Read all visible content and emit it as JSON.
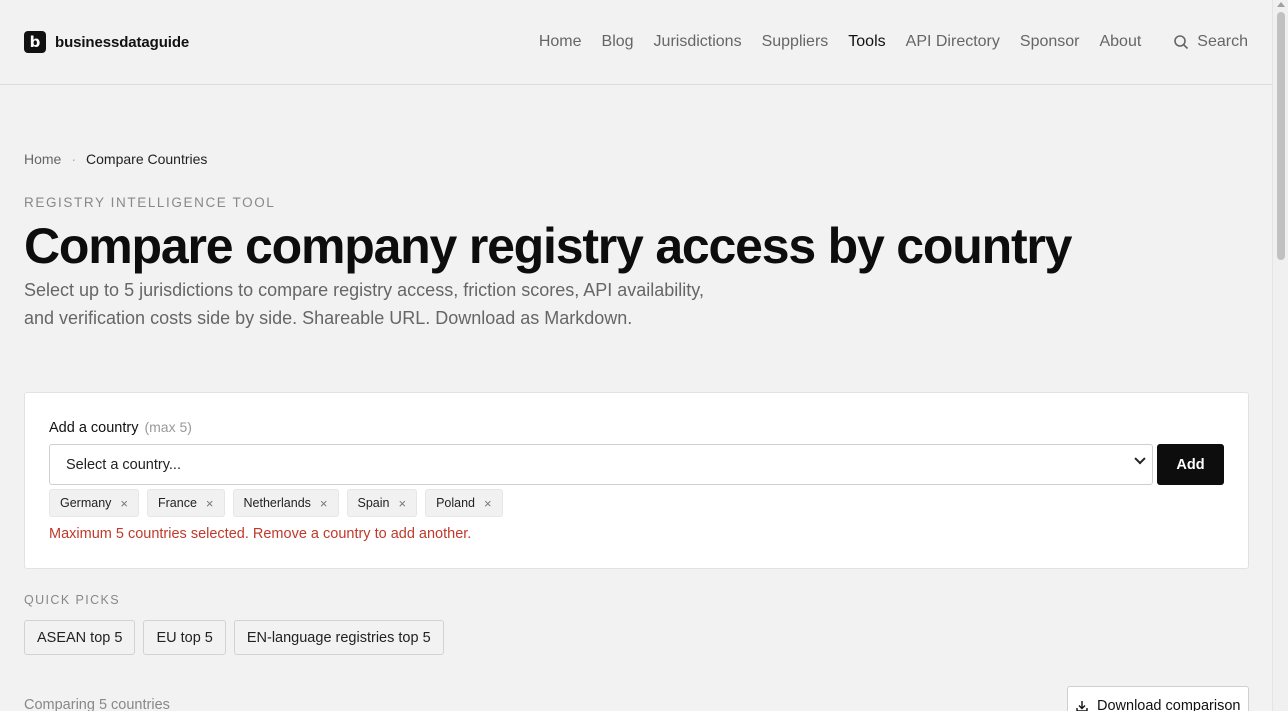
{
  "brand": {
    "mark": "b",
    "name": "businessdataguide"
  },
  "nav": {
    "items": [
      {
        "label": "Home",
        "active": false
      },
      {
        "label": "Blog",
        "active": false
      },
      {
        "label": "Jurisdictions",
        "active": false
      },
      {
        "label": "Suppliers",
        "active": false
      },
      {
        "label": "Tools",
        "active": true
      },
      {
        "label": "API Directory",
        "active": false
      },
      {
        "label": "Sponsor",
        "active": false
      },
      {
        "label": "About",
        "active": false
      }
    ],
    "search_label": "Search",
    "search_icon": "search-icon"
  },
  "breadcrumb": {
    "home": "Home",
    "separator": "·",
    "current": "Compare Countries"
  },
  "hero": {
    "eyebrow": "REGISTRY INTELLIGENCE TOOL",
    "title": "Compare company registry access by country",
    "subtitle": "Select up to 5 jurisdictions to compare registry access, friction scores, API availability, and verification costs side by side. Shareable URL. Download as Markdown."
  },
  "selector": {
    "label": "Add a country",
    "hint": "(max 5)",
    "select_value": "Select a country...",
    "add_label": "Add",
    "selected": [
      "Germany",
      "France",
      "Netherlands",
      "Spain",
      "Poland"
    ],
    "remove_glyph": "×",
    "error": "Maximum 5 countries selected. Remove a country to add another."
  },
  "quick_picks": {
    "label": "QUICK PICKS",
    "items": [
      "ASEAN top 5",
      "EU top 5",
      "EN-language registries top 5"
    ]
  },
  "comparison": {
    "count_label": "Comparing 5 countries",
    "download_label": "Download comparison",
    "download_icon": "download-icon"
  },
  "colors": {
    "accent": "#0d0d0d",
    "error": "#c0392b",
    "background": "#f2f2f2"
  }
}
